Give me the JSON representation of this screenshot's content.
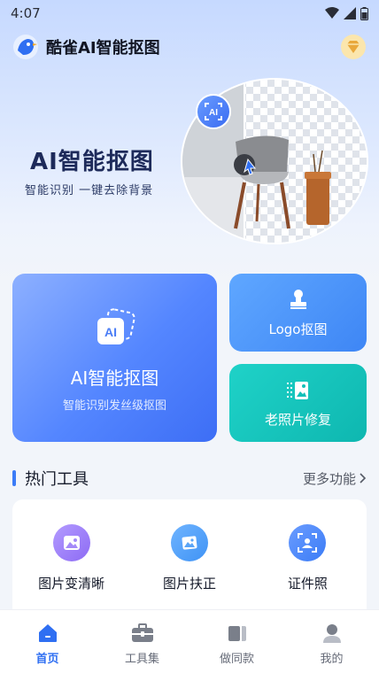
{
  "status_bar": {
    "time": "4:07"
  },
  "header": {
    "app_title": "酷雀AI智能抠图"
  },
  "hero": {
    "title": "AI智能抠图",
    "subtitle": "智能识别  一键去除背景",
    "badge_label": "AI"
  },
  "cards": {
    "main": {
      "title": "AI智能抠图",
      "subtitle": "智能识别发丝级抠图",
      "icon_label": "AI"
    },
    "logo": {
      "title": "Logo抠图"
    },
    "photo": {
      "title": "老照片修复"
    }
  },
  "hot_tools": {
    "title": "热门工具",
    "more": "更多功能",
    "items": [
      {
        "label": "图片变清晰",
        "icon": "image-enhance-icon",
        "color": "#8d6bf4"
      },
      {
        "label": "图片扶正",
        "icon": "image-straighten-icon",
        "color": "#3f93f5"
      },
      {
        "label": "证件照",
        "icon": "id-photo-icon",
        "color": "#3b7cf6"
      }
    ]
  },
  "tabbar": {
    "items": [
      {
        "label": "首页",
        "icon": "home-icon",
        "active": true
      },
      {
        "label": "工具集",
        "icon": "toolbox-icon",
        "active": false
      },
      {
        "label": "做同款",
        "icon": "template-icon",
        "active": false
      },
      {
        "label": "我的",
        "icon": "profile-icon",
        "active": false
      }
    ]
  },
  "colors": {
    "accent": "#3b7bf7",
    "teal": "#0eb7b0"
  }
}
